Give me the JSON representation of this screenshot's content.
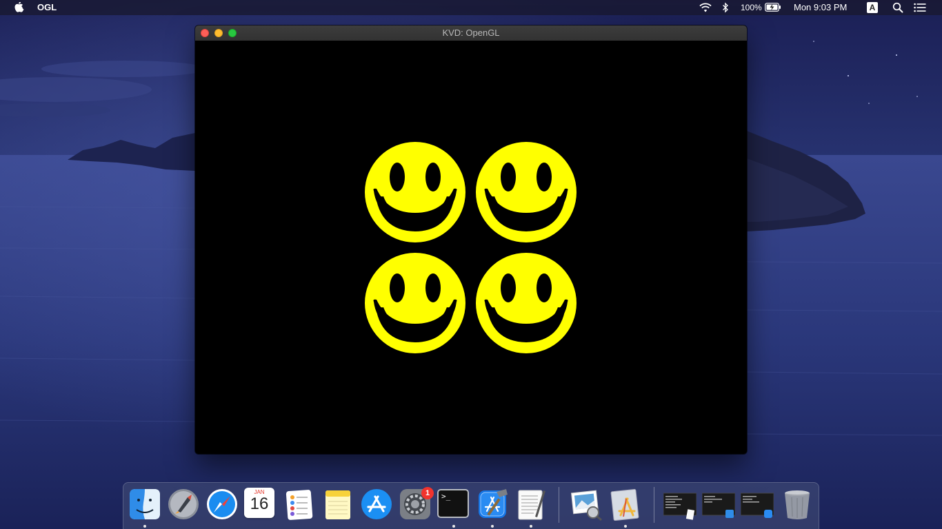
{
  "menubar": {
    "app_name": "OGL",
    "battery": "100%",
    "clock": "Mon 9:03 PM",
    "input_source": "A",
    "icons": [
      "apple-icon",
      "wifi-icon",
      "bluetooth-icon",
      "battery-icon",
      "input-source-icon",
      "spotlight-icon",
      "notification-center-icon"
    ]
  },
  "window": {
    "title": "KVD: OpenGL",
    "canvas_background": "#000000",
    "smiley_color": "#ffff00",
    "smiley_count": 4
  },
  "dock": {
    "apps": [
      {
        "name": "Finder",
        "icon": "finder-icon",
        "running": true
      },
      {
        "name": "Launchpad",
        "icon": "launchpad-icon",
        "running": false
      },
      {
        "name": "Safari",
        "icon": "safari-icon",
        "running": false
      },
      {
        "name": "Calendar",
        "icon": "calendar-icon",
        "running": false,
        "month": "JAN",
        "day": "16"
      },
      {
        "name": "Reminders",
        "icon": "reminders-icon",
        "running": false
      },
      {
        "name": "Notes",
        "icon": "notes-icon",
        "running": false
      },
      {
        "name": "App Store",
        "icon": "app-store-icon",
        "running": false
      },
      {
        "name": "System Preferences",
        "icon": "system-preferences-icon",
        "running": false,
        "badge": "1"
      },
      {
        "name": "Terminal",
        "icon": "terminal-icon",
        "running": true,
        "prompt": ">_"
      },
      {
        "name": "Xcode",
        "icon": "xcode-icon",
        "running": true
      },
      {
        "name": "TextEdit",
        "icon": "textedit-icon",
        "running": true
      },
      {
        "name": "Preview",
        "icon": "preview-icon",
        "running": false
      },
      {
        "name": "Applications",
        "icon": "applications-folder-icon",
        "running": true
      },
      {
        "name": "Minimized window 1",
        "icon": "minimized-window-icon",
        "running": false
      },
      {
        "name": "Minimized window 2",
        "icon": "minimized-window-icon",
        "running": false
      },
      {
        "name": "Minimized window 3",
        "icon": "minimized-window-icon",
        "running": false
      },
      {
        "name": "Trash",
        "icon": "trash-icon",
        "running": false
      }
    ]
  }
}
